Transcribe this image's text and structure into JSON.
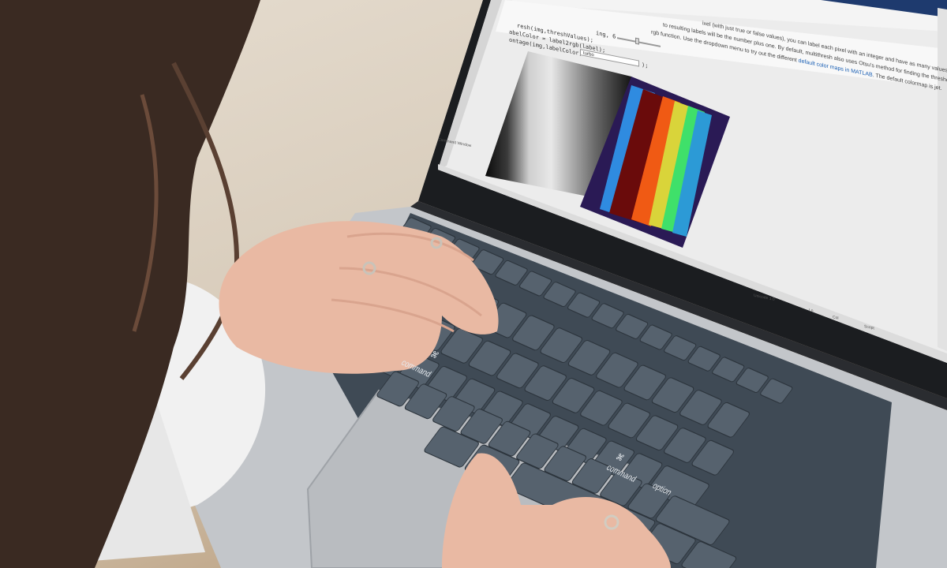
{
  "scene": {
    "description_colors": {
      "table": "#d8ccbb",
      "laptop_silver": "#c7c9cc",
      "keyboard_keys": "#4a5662",
      "screen_bg": "#ececec",
      "hair": "#3a2a22"
    }
  },
  "screen": {
    "code_lines": [
      "ing, 6",
      "resh(img,threshValues);",
      "abelColor = label2rgb(label);",
      "ontage(img,labelColor)"
    ],
    "dropdown_value": "turbo",
    "code_suffix": ");",
    "doc_lines": [
      "ixel (with just true or false values), you can label each pixel with an integer and have as many values as",
      "rgb function. Use the dropdown menu to try out the different",
      "to resulting labels will be the number plus one. By default, multithresh also uses Otsu's method for finding the threshold."
    ],
    "doc_link": "default color maps in MATLAB",
    "doc_tail": ". The default colormap is jet.",
    "status_left": "Command Window",
    "status_items": [
      "Unicode 1.0",
      "Ln",
      "Col",
      "Script"
    ]
  },
  "keyboard": {
    "labels": [
      "command",
      "command",
      "option",
      "⌘",
      "⌘"
    ]
  }
}
